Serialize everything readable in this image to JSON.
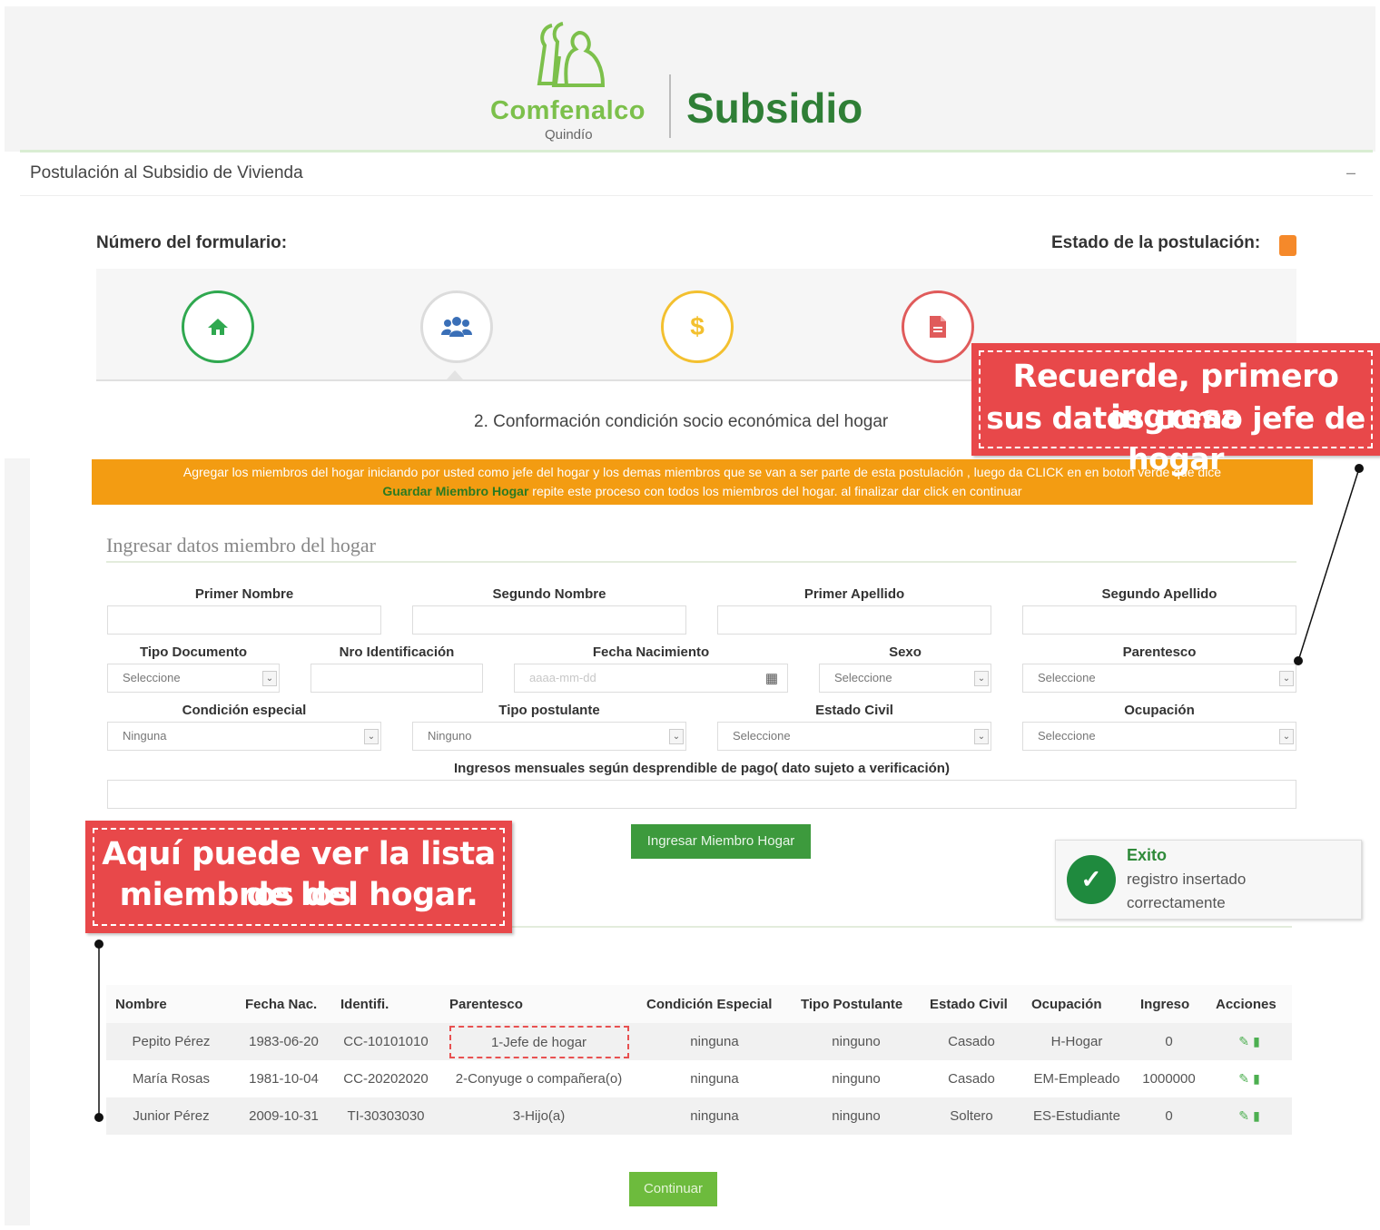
{
  "header": {
    "logo_text": "Comfenalco",
    "logo_sub": "Quindío",
    "brand_title": "Subsidio"
  },
  "panel": {
    "title": "Postulación al Subsidio de Vivienda",
    "collapse_symbol": "–",
    "form_number_label": "Número del formulario:",
    "status_label": "Estado de la postulación:",
    "status_color": "#f5892a"
  },
  "steps": {
    "icons": [
      "home-icon",
      "users-icon",
      "dollar-icon",
      "document-icon"
    ],
    "colors": [
      "#2fa84f",
      "#dcdcdc",
      "#f3c02f",
      "#e05b5b"
    ],
    "caption": "2. Conformación condición socio económica del hogar"
  },
  "info_bar": {
    "line1": "Agregar los miembros del hogar iniciando por usted como jefe del hogar y los demas miembros que se van a ser parte de esta postulación , luego da CLICK en en boton verde que dice",
    "highlight": "Guardar Miembro Hogar",
    "line2_rest": " repite este proceso con todos los miembros del hogar. al finalizar dar click en continuar"
  },
  "form": {
    "section_title": "Ingresar datos miembro del hogar",
    "primer_nombre": "Primer Nombre",
    "segundo_nombre": "Segundo Nombre",
    "primer_apellido": "Primer Apellido",
    "segundo_apellido": "Segundo Apellido",
    "tipo_documento": "Tipo Documento",
    "tipo_documento_value": "Seleccione",
    "nro_identificacion": "Nro Identificación",
    "fecha_nacimiento": "Fecha Nacimiento",
    "fecha_placeholder": "aaaa-mm-dd",
    "sexo": "Sexo",
    "sexo_value": "Seleccione",
    "parentesco": "Parentesco",
    "parentesco_value": "Seleccione",
    "condicion_especial": "Condición especial",
    "condicion_value": "Ninguna",
    "tipo_postulante": "Tipo postulante",
    "tipo_postulante_value": "Ninguno",
    "estado_civil": "Estado Civil",
    "estado_civil_value": "Seleccione",
    "ocupacion": "Ocupación",
    "ocupacion_value": "Seleccione",
    "ingresos": "Ingresos mensuales según desprendible de pago( dato sujeto a verificación)",
    "submit_label": "Ingresar Miembro Hogar"
  },
  "toast": {
    "title": "Exito",
    "message": "registro insertado correctamente"
  },
  "table": {
    "headers": [
      "Nombre",
      "Fecha Nac.",
      "Identifi.",
      "Parentesco",
      "Condición Especial",
      "Tipo Postulante",
      "Estado Civil",
      "Ocupación",
      "Ingreso",
      "Acciones"
    ],
    "rows": [
      [
        "Pepito Pérez",
        "1983-06-20",
        "CC-10101010",
        "1-Jefe de hogar",
        "ninguna",
        "ninguno",
        "Casado",
        "H-Hogar",
        "0"
      ],
      [
        "María Rosas",
        "1981-10-04",
        "CC-20202020",
        "2-Conyuge o compañera(o)",
        "ninguna",
        "ninguno",
        "Casado",
        "EM-Empleado",
        "1000000"
      ],
      [
        "Junior Pérez",
        "2009-10-31",
        "TI-30303030",
        "3-Hijo(a)",
        "ninguna",
        "ninguno",
        "Soltero",
        "ES-Estudiante",
        "0"
      ]
    ],
    "action_icons": [
      "edit-icon",
      "trash-icon"
    ]
  },
  "continue_label": "Continuar",
  "callouts": {
    "top_line1": "Recuerde, primero ingresa",
    "top_line2": "sus datos como jefe de hogar",
    "bottom_line1": "Aquí puede ver la lista de los",
    "bottom_line2": "miembros del hogar."
  }
}
